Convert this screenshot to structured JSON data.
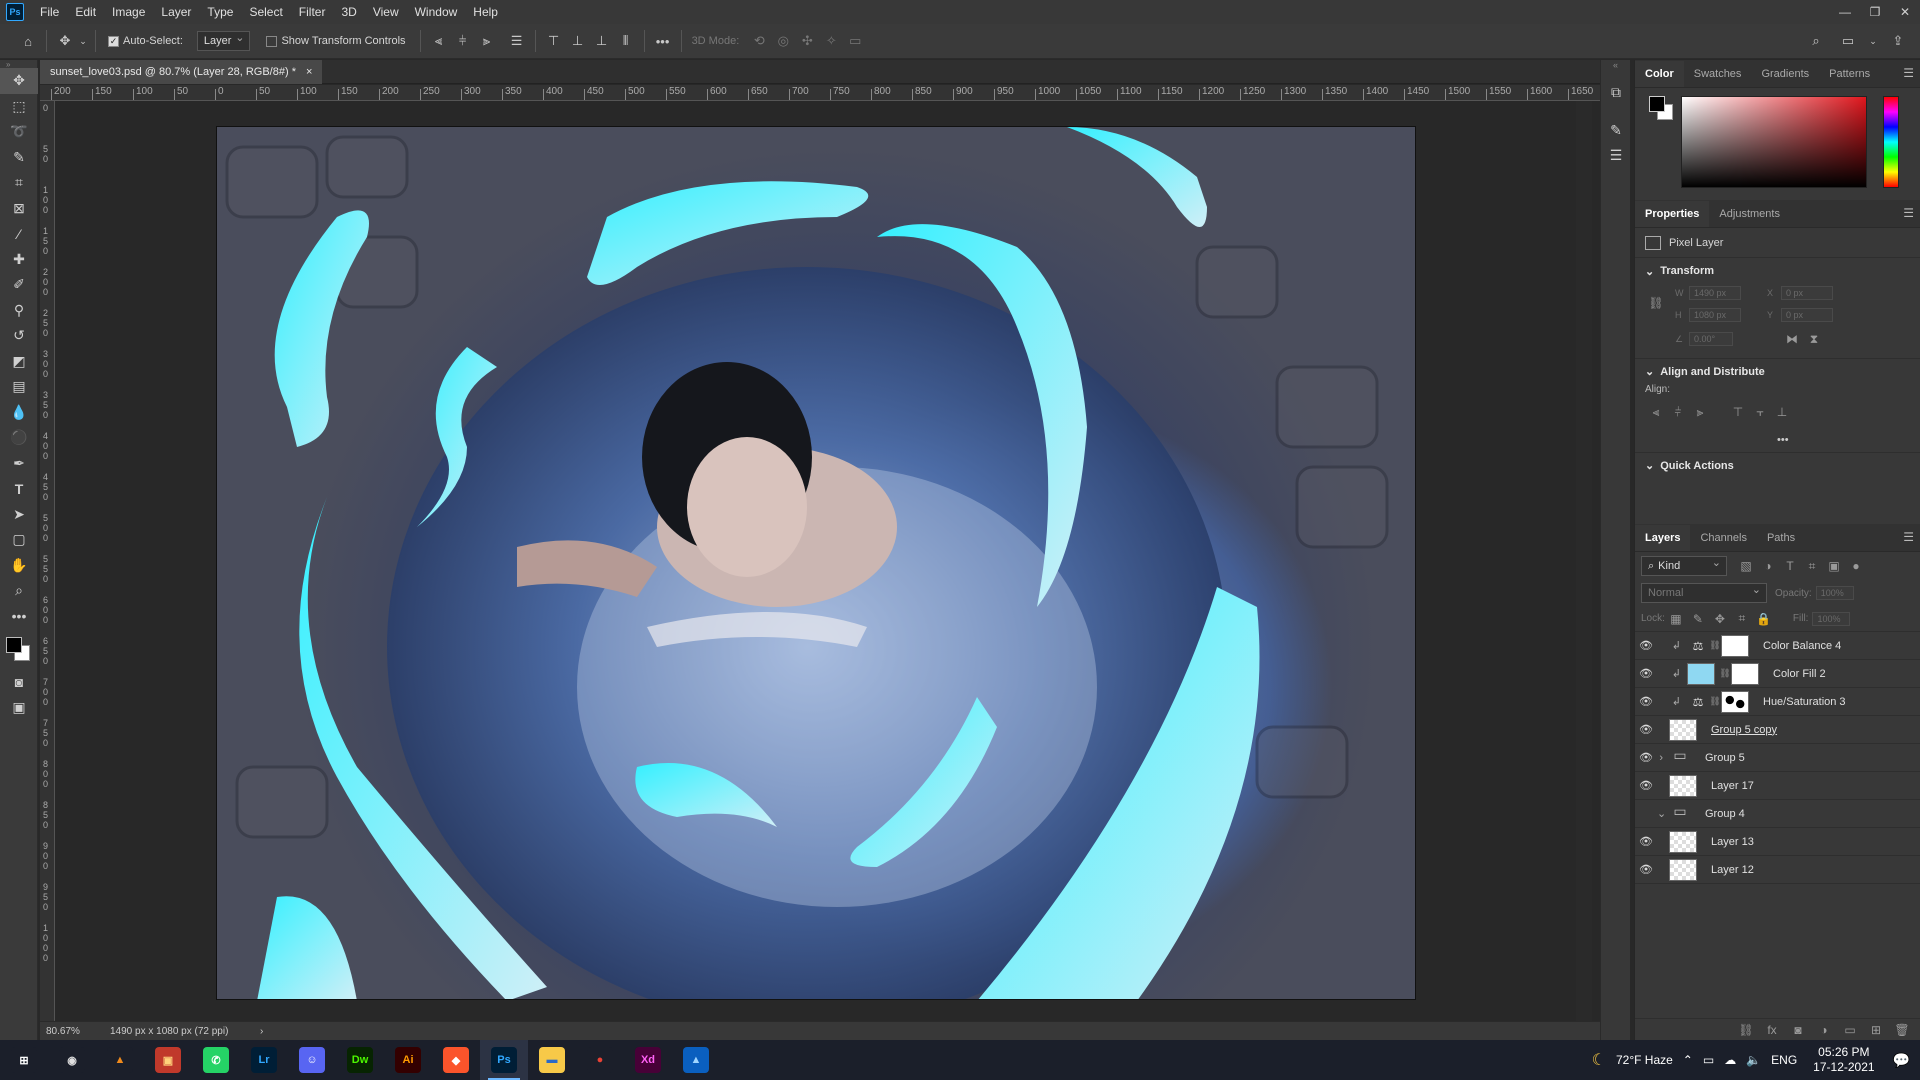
{
  "app": {
    "logo": "Ps"
  },
  "menu": [
    "File",
    "Edit",
    "Image",
    "Layer",
    "Type",
    "Select",
    "Filter",
    "3D",
    "View",
    "Window",
    "Help"
  ],
  "window_controls": [
    "—",
    "❐",
    "✕"
  ],
  "options": {
    "auto_select_label": "Auto-Select:",
    "auto_select_checked": true,
    "auto_select_value": "Layer",
    "show_transform_label": "Show Transform Controls",
    "show_transform_checked": false,
    "mode_3d_label": "3D Mode:",
    "more": "•••"
  },
  "document": {
    "tab_title": "sunset_love03.psd @ 80.7% (Layer 28, RGB/8#) *",
    "close": "×",
    "zoom": "80.67%",
    "info": "1490 px x 1080 px (72 ppi)",
    "arrow": "›"
  },
  "ruler_top": [
    "200",
    "150",
    "100",
    "50",
    "0",
    "50",
    "100",
    "150",
    "200",
    "250",
    "300",
    "350",
    "400",
    "450",
    "500",
    "550",
    "600",
    "650",
    "700",
    "750",
    "800",
    "850",
    "900",
    "950",
    "1000",
    "1050",
    "1100",
    "1150",
    "1200",
    "1250",
    "1300",
    "1350",
    "1400",
    "1450",
    "1500",
    "1550",
    "1600",
    "1650"
  ],
  "ruler_left": [
    "0",
    "50",
    "100",
    "150",
    "200",
    "250",
    "300",
    "350",
    "400",
    "450",
    "500",
    "550",
    "600",
    "650",
    "700",
    "750",
    "800",
    "850",
    "900",
    "950",
    "1000"
  ],
  "color_panel": {
    "tabs": [
      "Color",
      "Swatches",
      "Gradients",
      "Patterns"
    ],
    "active": 0
  },
  "properties": {
    "tabs": [
      "Properties",
      "Adjustments"
    ],
    "layer_kind": "Pixel Layer",
    "transform_title": "Transform",
    "w_label": "W",
    "w_value": "1490 px",
    "x_label": "X",
    "x_value": "0 px",
    "h_label": "H",
    "h_value": "1080 px",
    "y_label": "Y",
    "y_value": "0 px",
    "angle_value": "0.00°",
    "align_title": "Align and Distribute",
    "align_label": "Align:",
    "align_more": "•••",
    "quick_actions": "Quick Actions"
  },
  "layers_panel": {
    "tabs": [
      "Layers",
      "Channels",
      "Paths"
    ],
    "kind_label": "Kind",
    "blend_mode": "Normal",
    "opacity_label": "Opacity:",
    "opacity_value": "100%",
    "lock_label": "Lock:",
    "fill_label": "Fill:",
    "fill_value": "100%",
    "layers": [
      {
        "name": "Color Balance 4",
        "thumb": "adj",
        "mask": "white",
        "visible": true,
        "clipped": true
      },
      {
        "name": "Color Fill 2",
        "thumb": "cyan",
        "mask": "white",
        "visible": true,
        "clipped": true
      },
      {
        "name": "Hue/Saturation 3",
        "thumb": "adj",
        "mask": "spots",
        "visible": true,
        "clipped": true
      },
      {
        "name": "Group 5 copy",
        "thumb": "smart",
        "mask": "",
        "visible": true,
        "clipped": false
      },
      {
        "name": "Group 5",
        "thumb": "folder",
        "mask": "",
        "visible": true,
        "clipped": false
      },
      {
        "name": "Layer 17",
        "thumb": "checker",
        "mask": "",
        "visible": true,
        "clipped": false
      },
      {
        "name": "Group 4",
        "thumb": "folder",
        "mask": "",
        "visible": false,
        "clipped": false
      },
      {
        "name": "Layer 13",
        "thumb": "checker",
        "mask": "",
        "visible": true,
        "clipped": false
      },
      {
        "name": "Layer 12",
        "thumb": "checker",
        "mask": "",
        "visible": true,
        "clipped": false
      }
    ],
    "footer_icons": [
      "link-icon",
      "fx-icon",
      "mask-icon",
      "adjustment-icon",
      "folder-icon",
      "new-layer-icon",
      "trash-icon"
    ]
  },
  "taskbar": {
    "apps": [
      {
        "name": "start-icon",
        "label": "⊞",
        "bg": "#1b1f2a",
        "fg": "#ffffff"
      },
      {
        "name": "obs-icon",
        "label": "◉",
        "bg": "#1b1f2a",
        "fg": "#e0e0e0"
      },
      {
        "name": "vlc-icon",
        "label": "▲",
        "bg": "#1b1f2a",
        "fg": "#f08a1c"
      },
      {
        "name": "app-icon",
        "label": "▣",
        "bg": "#c0392b",
        "fg": "#ffd27a"
      },
      {
        "name": "whatsapp-icon",
        "label": "✆",
        "bg": "#25d366",
        "fg": "#ffffff"
      },
      {
        "name": "lightroom-icon",
        "label": "Lr",
        "bg": "#001e36",
        "fg": "#31a8ff"
      },
      {
        "name": "discord-icon",
        "label": "☺",
        "bg": "#5865f2",
        "fg": "#ffffff"
      },
      {
        "name": "dreamweaver-icon",
        "label": "Dw",
        "bg": "#072401",
        "fg": "#4cf600"
      },
      {
        "name": "illustrator-icon",
        "label": "Ai",
        "bg": "#330000",
        "fg": "#ff9a00"
      },
      {
        "name": "brave-icon",
        "label": "◆",
        "bg": "#fb542b",
        "fg": "#ffffff"
      },
      {
        "name": "photoshop-icon",
        "label": "Ps",
        "bg": "#001e36",
        "fg": "#31a8ff",
        "active": true
      },
      {
        "name": "file-explorer-icon",
        "label": "▬",
        "bg": "#f7c948",
        "fg": "#2a6ac8"
      },
      {
        "name": "chrome-icon",
        "label": "●",
        "bg": "#1b1f2a",
        "fg": "#e94235"
      },
      {
        "name": "xd-icon",
        "label": "Xd",
        "bg": "#470137",
        "fg": "#ff61f6"
      },
      {
        "name": "photos-icon",
        "label": "▲",
        "bg": "#0a5fbf",
        "fg": "#9fd5ff"
      }
    ],
    "weather": "72°F  Haze",
    "language": "ENG",
    "time": "05:26 PM",
    "date": "17-12-2021"
  }
}
